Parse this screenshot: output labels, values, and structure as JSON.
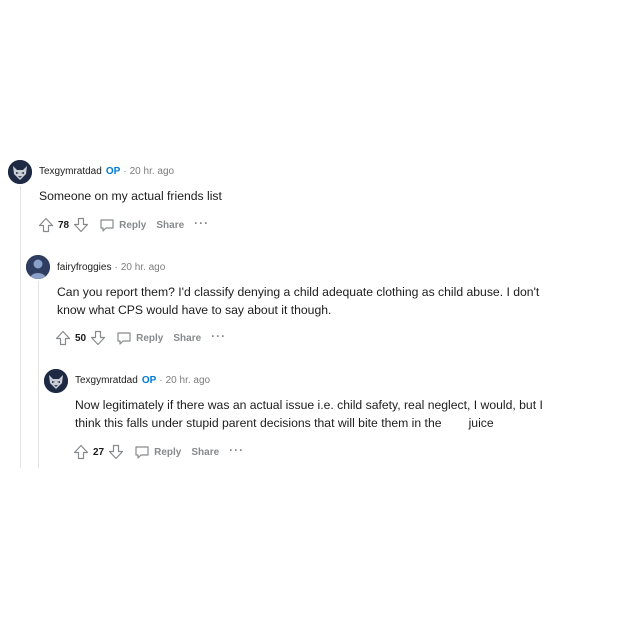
{
  "comments": [
    {
      "author": "Texgymratdad",
      "op_badge": "OP",
      "separator": "·",
      "time": "20 hr. ago",
      "lines": [
        "Someone on my actual friends list"
      ],
      "score": "78",
      "reply_label": "Reply",
      "share_label": "Share",
      "more_label": "···"
    },
    {
      "author": "fairyfroggies",
      "separator": "·",
      "time": "20 hr. ago",
      "lines": [
        "Can you report them? I'd classify denying a child adequate clothing as child abuse. I don't",
        "know what CPS would have to say about it though."
      ],
      "score": "50",
      "reply_label": "Reply",
      "share_label": "Share",
      "more_label": "···"
    },
    {
      "author": "Texgymratdad",
      "op_badge": "OP",
      "separator": "·",
      "time": "20 hr. ago",
      "lines": [
        "Now legitimately if there was an actual issue i.e. child safety, real neglect, I would, but I",
        "think this falls under stupid parent decisions that will bite them in the        juice"
      ],
      "score": "27",
      "reply_label": "Reply",
      "share_label": "Share",
      "more_label": "···"
    }
  ],
  "icons": {
    "upvote": "upvote-icon",
    "downvote": "downvote-icon",
    "reply": "comment-bubble-icon",
    "more": "more-dots-icon"
  },
  "colors": {
    "op": "#0079d3",
    "meta": "#7c7c7c",
    "action": "#878a8c",
    "thread_line": "#e3e3e3"
  }
}
